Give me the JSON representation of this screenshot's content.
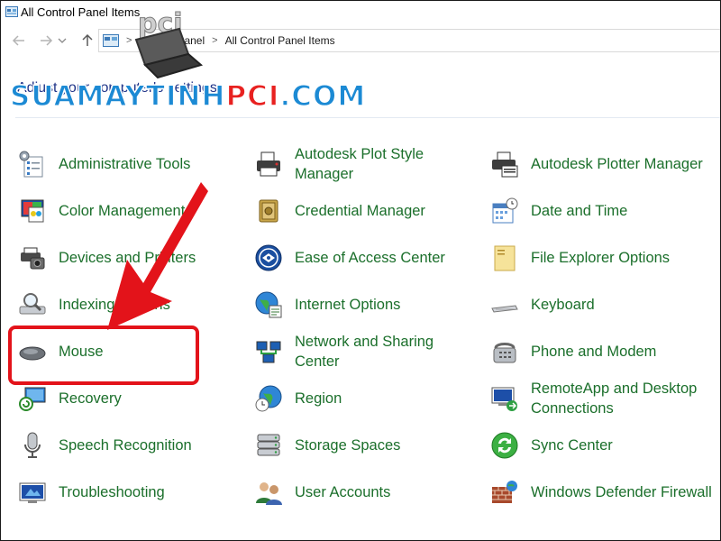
{
  "window": {
    "title": "All Control Panel Items"
  },
  "navbar": {
    "back_icon": "arrow-left-icon",
    "forward_icon": "arrow-right-icon",
    "recent_icon": "chevron-down-icon",
    "up_icon": "arrow-up-icon",
    "address": {
      "separator": ">",
      "crumbs": [
        "Control Panel",
        "All Control Panel Items"
      ]
    }
  },
  "heading": "Adjust your computer's settings",
  "items": [
    {
      "label": "Administrative Tools",
      "icon": "administrative-tools-icon"
    },
    {
      "label": "Autodesk Plot Style Manager",
      "icon": "printer-icon"
    },
    {
      "label": "Autodesk Plotter Manager",
      "icon": "plotter-icon"
    },
    {
      "label": "Color Management",
      "icon": "color-management-icon"
    },
    {
      "label": "Credential Manager",
      "icon": "credential-vault-icon"
    },
    {
      "label": "Date and Time",
      "icon": "calendar-clock-icon"
    },
    {
      "label": "Devices and Printers",
      "icon": "devices-printers-icon"
    },
    {
      "label": "Ease of Access Center",
      "icon": "ease-of-access-icon"
    },
    {
      "label": "File Explorer Options",
      "icon": "folder-options-icon"
    },
    {
      "label": "Indexing Options",
      "icon": "indexing-icon"
    },
    {
      "label": "Internet Options",
      "icon": "globe-icon"
    },
    {
      "label": "Keyboard",
      "icon": "keyboard-icon"
    },
    {
      "label": "Mouse",
      "icon": "mouse-icon"
    },
    {
      "label": "Network and Sharing Center",
      "icon": "network-icon"
    },
    {
      "label": "Phone and Modem",
      "icon": "phone-icon"
    },
    {
      "label": "Recovery",
      "icon": "recovery-icon"
    },
    {
      "label": "Region",
      "icon": "region-globe-icon"
    },
    {
      "label": "RemoteApp and Desktop Connections",
      "icon": "remote-desktop-icon"
    },
    {
      "label": "Speech Recognition",
      "icon": "microphone-icon"
    },
    {
      "label": "Storage Spaces",
      "icon": "storage-icon"
    },
    {
      "label": "Sync Center",
      "icon": "sync-icon"
    },
    {
      "label": "Troubleshooting",
      "icon": "troubleshooting-icon"
    },
    {
      "label": "User Accounts",
      "icon": "users-icon"
    },
    {
      "label": "Windows Defender Firewall",
      "icon": "firewall-icon"
    }
  ],
  "watermark": {
    "logo_text": "pci",
    "text_part1": "SUAMAYTINH",
    "text_part2": "PCI",
    "text_part3": ".COM"
  },
  "colors": {
    "link_green": "#1b6f2b",
    "heading_blue": "#1e3287",
    "highlight_red": "#e3131a",
    "watermark_blue": "#1c8ad4",
    "watermark_red": "#e82120"
  }
}
